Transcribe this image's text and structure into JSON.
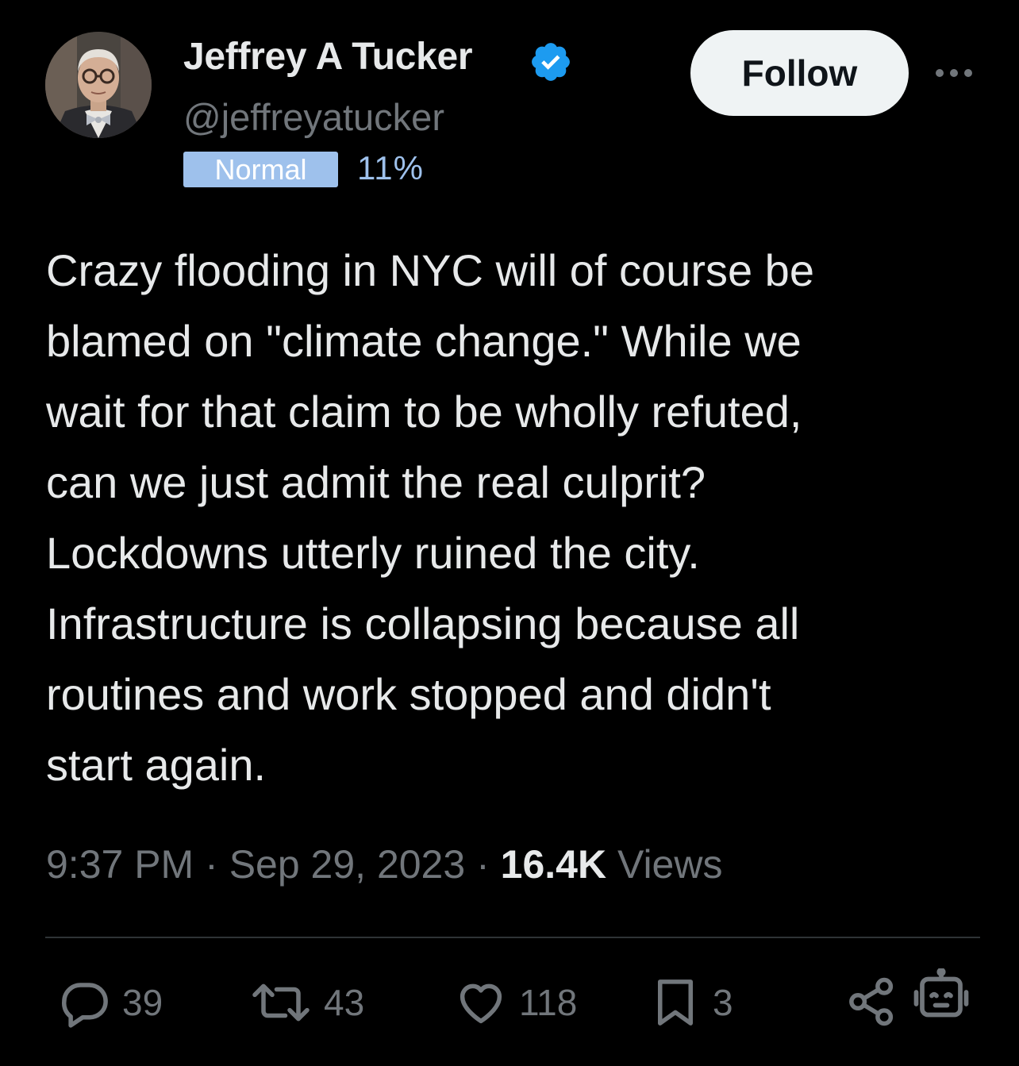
{
  "author": {
    "name": "Jeffrey A Tucker",
    "handle": "@jeffreyatucker",
    "verified": true,
    "verified_color": "#1d9bf0"
  },
  "badge": {
    "label": "Normal",
    "percent": "11%",
    "color": "#9ec1ec"
  },
  "header": {
    "follow_label": "Follow",
    "more_icon": "ellipsis-icon"
  },
  "tweet": {
    "text": "Crazy flooding in NYC will of course be\nblamed on \"climate change.\" While we\nwait for that claim to be wholly refuted,\ncan we just admit the real culprit?\nLockdowns utterly ruined the city.\nInfrastructure is collapsing because all\nroutines and work stopped and didn't\nstart again."
  },
  "meta": {
    "time": "9:37 PM",
    "separator": "·",
    "date": "Sep 29, 2023",
    "views_count": "16.4K",
    "views_label": "Views"
  },
  "actions": {
    "replies": {
      "icon": "reply-icon",
      "count": "39"
    },
    "reposts": {
      "icon": "repost-icon",
      "count": "43"
    },
    "likes": {
      "icon": "heart-icon",
      "count": "118"
    },
    "bookmarks": {
      "icon": "bookmark-icon",
      "count": "3"
    },
    "share": {
      "icon": "share-icon"
    },
    "grok": {
      "icon": "robot-icon"
    }
  },
  "colors": {
    "background": "#000000",
    "text_primary": "#e7e9ea",
    "text_secondary": "#71767b",
    "divider": "#2f3336"
  }
}
